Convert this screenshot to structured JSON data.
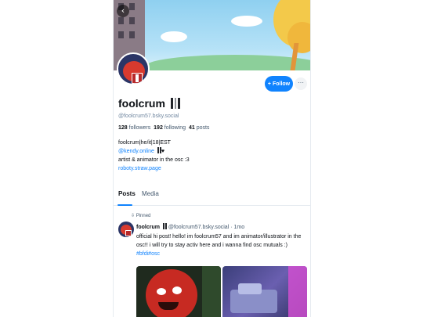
{
  "profile": {
    "display_name": "foolcrum",
    "handle": "@foolcrum57.bsky.social",
    "followers_count": "128",
    "followers_label": "followers",
    "following_count": "192",
    "following_label": "following",
    "posts_count": "41",
    "posts_label": "posts",
    "bio_line1": "foolcrum|he/it|18|EST",
    "bio_link1": "@kendy.online",
    "bio_link1_suffix": "♥",
    "bio_line3": "artist & animator in the osc :3",
    "bio_link2": "roboty.straw.page"
  },
  "actions": {
    "follow_label": "Follow",
    "follow_icon": "+",
    "more_icon": "···",
    "back_icon": "‹"
  },
  "tabs": [
    {
      "label": "Posts",
      "active": true
    },
    {
      "label": "Media",
      "active": false
    }
  ],
  "post": {
    "pinned_label": "Pinned",
    "author": "foolcrum",
    "handle": "@foolcrum57.bsky.social",
    "separator": "·",
    "time": "1mo",
    "text": "official hi post! hello! im foolcrum57 and im animator/illustrator in the osc!! i will try to stay activ here and i wanna find osc mutuals :)",
    "tags": "#bfdi#osc"
  },
  "colors": {
    "accent": "#1083fe",
    "text_primary": "#0b0f14",
    "text_secondary": "#42576c"
  }
}
